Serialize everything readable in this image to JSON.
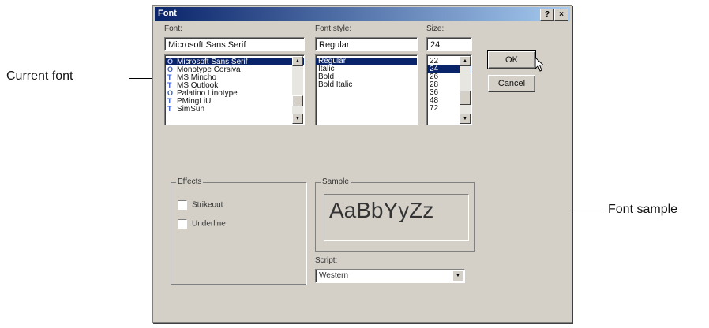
{
  "annotations": {
    "current_font": "Current font",
    "font_sample": "Font sample"
  },
  "dialog": {
    "title": "Font",
    "help_button": "?",
    "close_button": "×"
  },
  "font": {
    "label": "Font:",
    "value": "Microsoft Sans Serif",
    "items": [
      {
        "icon": "O",
        "label": "Microsoft Sans Serif",
        "selected": true
      },
      {
        "icon": "O",
        "label": "Monotype Corsiva",
        "selected": false
      },
      {
        "icon": "T",
        "label": "MS Mincho",
        "selected": false
      },
      {
        "icon": "T",
        "label": "MS Outlook",
        "selected": false
      },
      {
        "icon": "O",
        "label": "Palatino Linotype",
        "selected": false
      },
      {
        "icon": "T",
        "label": "PMingLiU",
        "selected": false
      },
      {
        "icon": "T",
        "label": "SimSun",
        "selected": false
      }
    ]
  },
  "style": {
    "label": "Font style:",
    "value": "Regular",
    "items": [
      {
        "label": "Regular",
        "selected": true
      },
      {
        "label": "Italic",
        "selected": false
      },
      {
        "label": "Bold",
        "selected": false
      },
      {
        "label": "Bold Italic",
        "selected": false
      }
    ]
  },
  "size": {
    "label": "Size:",
    "value": "24",
    "items": [
      {
        "label": "22",
        "selected": false
      },
      {
        "label": "24",
        "selected": true
      },
      {
        "label": "26",
        "selected": false
      },
      {
        "label": "28",
        "selected": false
      },
      {
        "label": "36",
        "selected": false
      },
      {
        "label": "48",
        "selected": false
      },
      {
        "label": "72",
        "selected": false
      }
    ]
  },
  "buttons": {
    "ok": "OK",
    "cancel": "Cancel"
  },
  "effects": {
    "title": "Effects",
    "strikeout": "Strikeout",
    "underline": "Underline"
  },
  "sample": {
    "title": "Sample",
    "text": "AaBbYyZz"
  },
  "script": {
    "label": "Script:",
    "value": "Western"
  },
  "colors": {
    "title_start": "#0a246a",
    "title_end": "#a6caf0",
    "dialog_bg": "#d4d0c8",
    "selection": "#0a246a"
  }
}
